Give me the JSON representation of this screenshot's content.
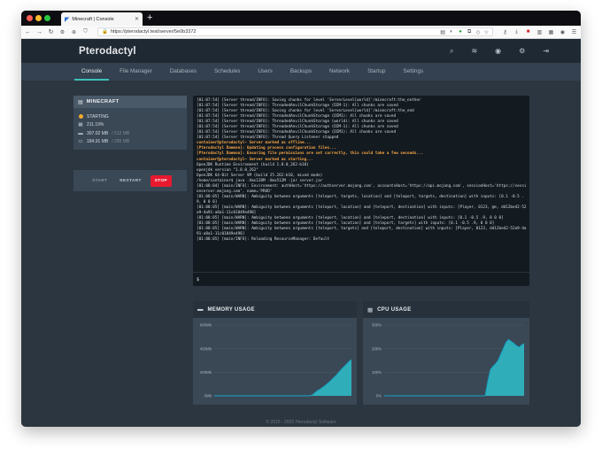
{
  "browser": {
    "tab_title": "Minecraft | Console",
    "url": "https://pterodactyl.test/server/5e0b3372",
    "new_tab_symbol": "+"
  },
  "app": {
    "brand": "Pterodactyl",
    "nav": [
      "Console",
      "File Manager",
      "Databases",
      "Schedules",
      "Users",
      "Backups",
      "Network",
      "Startup",
      "Settings"
    ],
    "active_nav": "Console"
  },
  "server": {
    "name": "MINECRAFT",
    "status": "STARTING",
    "status_color": "#f0a92e",
    "cpu": "211.19%",
    "memory": "307.02 MB",
    "memory_max": "/ 512 MB",
    "disk": "184.91 MB",
    "disk_max": "/ 200 MB"
  },
  "power": {
    "start": "START",
    "restart": "RESTART",
    "stop": "STOP"
  },
  "console": {
    "lines": [
      {
        "text": "[01:07:54] [Server thread/INFO]: Saving chunks for level 'ServerLevel[world]'/minecraft:the_nether",
        "style": ""
      },
      {
        "text": "[01:07:54] [Server thread/INFO]: ThreadedAnvilChunkStorage (DIM-1): All chunks are saved",
        "style": ""
      },
      {
        "text": "[01:07:54] [Server thread/INFO]: Saving chunks for level 'ServerLevel[world]'/minecraft:the_end",
        "style": ""
      },
      {
        "text": "[01:07:54] [Server thread/INFO]: ThreadedAnvilChunkStorage (DIM1): All chunks are saved",
        "style": ""
      },
      {
        "text": "[01:07:54] [Server thread/INFO]: ThreadedAnvilChunkStorage (world): All chunks are saved",
        "style": ""
      },
      {
        "text": "[01:07:54] [Server thread/INFO]: ThreadedAnvilChunkStorage (DIM-1): All chunks are saved",
        "style": ""
      },
      {
        "text": "[01:07:54] [Server thread/INFO]: ThreadedAnvilChunkStorage (DIM1): All chunks are saved",
        "style": ""
      },
      {
        "text": "[01:07:54] [Server thread/INFO]: Thread Query Listener stopped",
        "style": ""
      },
      {
        "text": "container@pterodactyl~ Server marked as offline...",
        "style": "amber"
      },
      {
        "text": "[Pterodactyl Daemon]: Updating process configuration files...",
        "style": "amber"
      },
      {
        "text": "[Pterodactyl Daemon]: Ensuring file permissions are set correctly, this could take a few seconds...",
        "style": "amber"
      },
      {
        "text": "container@pterodactyl~ Server marked as starting...",
        "style": "amber"
      },
      {
        "text": "OpenJDK Runtime Environment (build 1.8.0_262-b10)",
        "style": ""
      },
      {
        "text": "openjdk version \"1.8.0_262\"",
        "style": ""
      },
      {
        "text": "OpenJDK 64-Bit Server VM (build 25.262-b10, mixed mode)",
        "style": ""
      },
      {
        "text": "/home/container$ java -Xms128M -Xmx512M -jar server.jar",
        "style": ""
      },
      {
        "text": "[01:08:04] [main/INFO]: Environment: authHost='https://authserver.mojang.com', accountsHost='https://api.mojang.com', sessionHost='https://sessionserver.mojang.com', name='PROD'",
        "style": ""
      },
      {
        "text": "[01:08:05] [main/WARN]: Ambiguity between arguments [teleport, targets, location] and [teleport, targets, destination] with inputs: [0.1 -0.5 .9, 0 0 0]",
        "style": ""
      },
      {
        "text": "[01:08:05] [main/WARN]: Ambiguity between arguments [teleport, location] and [teleport, destination] with inputs: [Player, 0123, @e, dd12be42-52a9-4a91-a8a1-11c01849e498]",
        "style": ""
      },
      {
        "text": "[01:08:05] [main/WARN]: Ambiguity between arguments [teleport, location] and [teleport, destination] with inputs: [0.1 -0.5 .9, 0 0 0]",
        "style": ""
      },
      {
        "text": "[01:08:05] [main/WARN]: Ambiguity between arguments [teleport, location] and [teleport, targets] with inputs: [0.1 -0.5 .9, 0 0 0]",
        "style": ""
      },
      {
        "text": "[01:08:05] [main/WARN]: Ambiguity between arguments [teleport, targets] and [teleport, destination] with inputs: [Player, 0123, dd12be42-52a9-4a91-a8a1-11c01849e498]",
        "style": ""
      },
      {
        "text": "[01:08:05] [main/INFO]: Reloading ResourceManager: Default",
        "style": ""
      }
    ],
    "prompt": "$"
  },
  "graphs": {
    "memory": {
      "title": "MEMORY USAGE",
      "y_ticks": [
        "600Mb",
        "400Mb",
        "200Mb",
        "0Mb"
      ],
      "y_max": 600,
      "values": [
        0,
        0,
        0,
        0,
        0,
        0,
        0,
        0,
        0,
        0,
        0,
        0,
        0,
        0,
        0,
        0,
        0,
        0,
        0,
        0,
        0,
        0,
        0,
        0,
        0,
        0,
        0,
        0,
        0,
        0,
        0,
        0,
        0,
        0,
        0,
        0,
        0,
        0,
        0,
        0,
        2,
        10,
        28,
        45,
        55,
        70,
        85,
        102,
        120,
        140,
        160,
        180,
        205,
        228,
        248,
        268,
        290,
        305
      ]
    },
    "cpu": {
      "title": "CPU USAGE",
      "y_ticks": [
        "300%",
        "200%",
        "100%",
        "0%"
      ],
      "y_max": 300,
      "values": [
        0,
        0,
        0,
        0,
        0,
        0,
        0,
        0,
        0,
        0,
        0,
        0,
        0,
        0,
        0,
        0,
        0,
        0,
        0,
        0,
        0,
        0,
        0,
        0,
        0,
        0,
        0,
        0,
        0,
        0,
        0,
        0,
        0,
        0,
        0,
        0,
        0,
        0,
        0,
        0,
        60,
        110,
        125,
        135,
        150,
        175,
        200,
        225,
        238,
        230,
        222,
        212,
        205,
        214,
        221
      ]
    },
    "line_color": "#16a6c8",
    "fill_color": "#2fb9c4"
  },
  "footer": "© 2015 - 2020 Pterodactyl Software"
}
